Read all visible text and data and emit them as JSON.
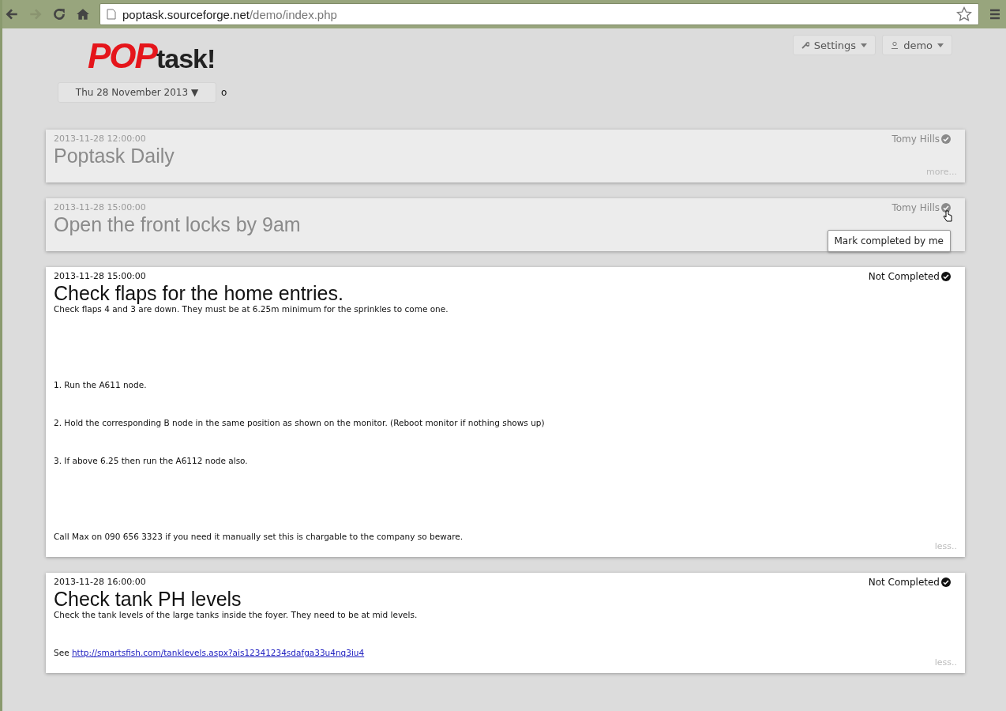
{
  "browser": {
    "url_host": "poptask.sourceforge.net",
    "url_path": "/demo/index.php"
  },
  "header": {
    "logo_pop": "POP",
    "logo_task": "task!",
    "date_button": "Thu 28 November 2013 ▼",
    "status_dot": "o",
    "menus": [
      {
        "kind": "settings",
        "label": "Settings"
      },
      {
        "kind": "user",
        "label": "demo"
      }
    ]
  },
  "tasks": [
    {
      "time": "2013-11-28 12:00:00",
      "title": "Poptask Daily",
      "status": "Tomy Hills",
      "completed": true,
      "toggle": "more..."
    },
    {
      "time": "2013-11-28 15:00:00",
      "title": "Open the front locks by 9am",
      "status": "Tomy Hills",
      "completed": true,
      "tooltip": "Mark completed by me"
    },
    {
      "time": "2013-11-28 15:00:00",
      "title": "Check flaps for the home entries.",
      "status": "Not Completed",
      "completed": false,
      "toggle": "less..",
      "paragraphs": [
        {
          "text": "Check flaps 4 and 3 are down. They must be at 6.25m minimum for the sprinkles to come one."
        },
        {
          "text": "1. Run the A611 node.",
          "spaced": true
        },
        {
          "text": "2. Hold the corresponding B node in the same position as shown on the monitor. (Reboot monitor if nothing shows up)"
        },
        {
          "text": "3. If above 6.25 then run the A6112 node also."
        },
        {
          "text": "Call Max on 090 656 3323 if you need it manually set this is chargable to the company so beware.",
          "spaced": true
        }
      ]
    },
    {
      "time": "2013-11-28 16:00:00",
      "title": "Check tank PH levels",
      "status": "Not Completed",
      "completed": false,
      "toggle": "less..",
      "paragraphs": [
        {
          "text": "Check the tank levels of the large tanks inside the foyer. They need to be at mid levels."
        },
        {
          "text": "See ",
          "link": "http://smartsfish.com/tanklevels.aspx?ais12341234sdafga33u4nq3iu4"
        }
      ]
    }
  ]
}
